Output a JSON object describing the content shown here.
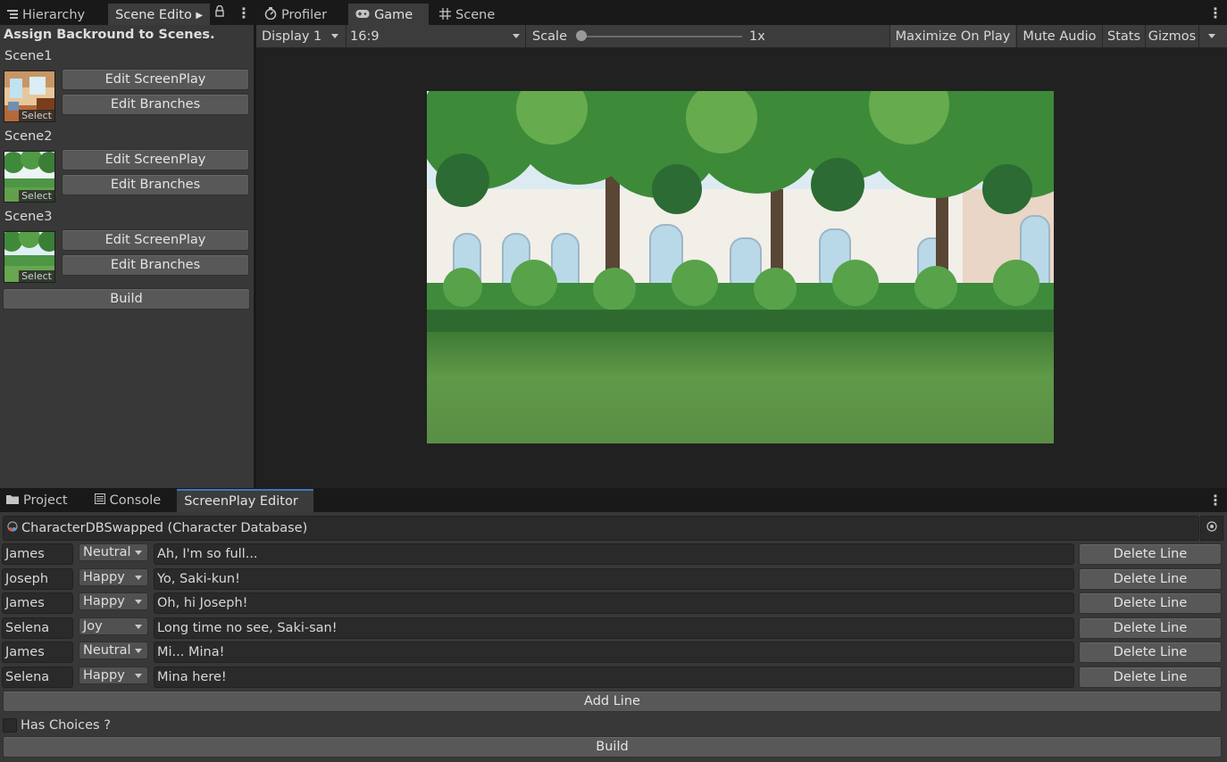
{
  "left_tabs": {
    "hierarchy": "Hierarchy",
    "scene_editor": "Scene Editor"
  },
  "main_tabs": {
    "profiler": "Profiler",
    "game": "Game",
    "scene": "Scene"
  },
  "scene_editor": {
    "title": "Assign Backround to Scenes.",
    "select_label": "Select",
    "scenes": [
      {
        "name": "Scene1",
        "edit_screenplay": "Edit ScreenPlay",
        "edit_branches": "Edit Branches"
      },
      {
        "name": "Scene2",
        "edit_screenplay": "Edit ScreenPlay",
        "edit_branches": "Edit Branches"
      },
      {
        "name": "Scene3",
        "edit_screenplay": "Edit ScreenPlay",
        "edit_branches": "Edit Branches"
      }
    ],
    "build": "Build"
  },
  "game_toolbar": {
    "display": "Display 1",
    "aspect": "16:9",
    "scale_label": "Scale",
    "scale_value": "1x",
    "maximize": "Maximize On Play",
    "mute": "Mute Audio",
    "stats": "Stats",
    "gizmos": "Gizmos"
  },
  "bottom_tabs": {
    "project": "Project",
    "console": "Console",
    "screenplay": "ScreenPlay Editor"
  },
  "screenplay": {
    "database": "CharacterDBSwapped (Character Database)",
    "lines": [
      {
        "character": "James",
        "emotion": "Neutral",
        "text": "Ah, I'm so full...",
        "delete": "Delete Line"
      },
      {
        "character": "Joseph",
        "emotion": "Happy",
        "text": "Yo, Saki-kun!",
        "delete": "Delete Line"
      },
      {
        "character": "James",
        "emotion": "Happy",
        "text": "Oh, hi Joseph!",
        "delete": "Delete Line"
      },
      {
        "character": "Selena",
        "emotion": "Joy",
        "text": "Long time no see, Saki-san!",
        "delete": "Delete Line"
      },
      {
        "character": "James",
        "emotion": "Neutral",
        "text": "Mi... Mina!",
        "delete": "Delete Line"
      },
      {
        "character": "Selena",
        "emotion": "Happy",
        "text": "Mina here!",
        "delete": "Delete Line"
      }
    ],
    "add_line": "Add Line",
    "has_choices": "Has Choices ?",
    "build": "Build"
  },
  "colors": {
    "panel": "#383838",
    "button": "#585858",
    "field": "#2a2a2a",
    "tab_accent": "#3a79bb"
  }
}
